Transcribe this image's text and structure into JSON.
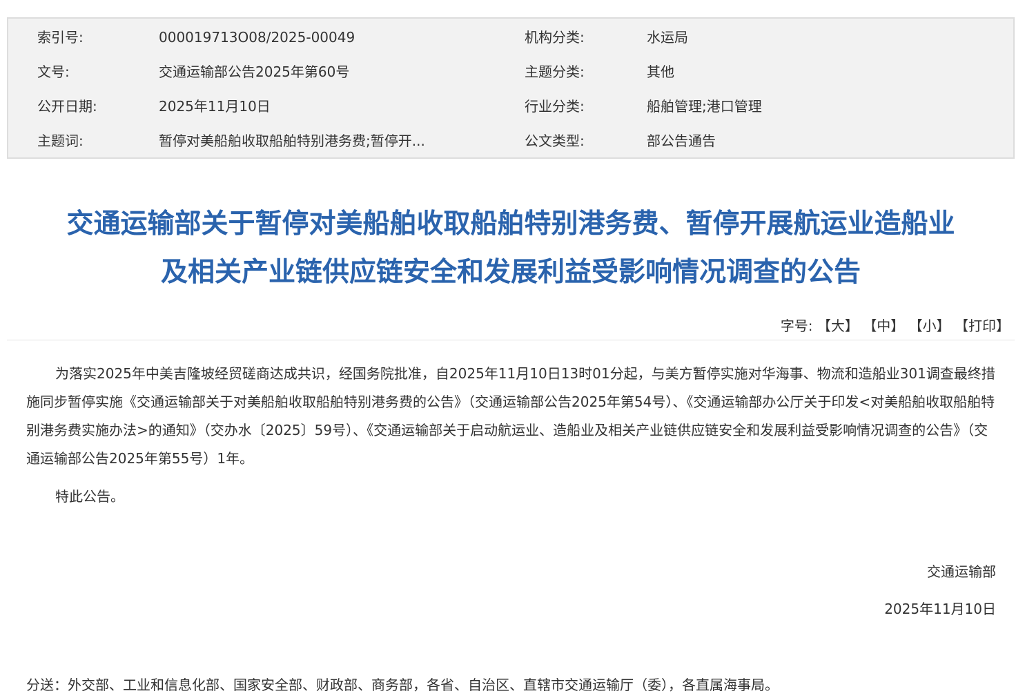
{
  "meta": {
    "index_label": "索引号:",
    "index_value": "000019713O08/2025-00049",
    "org_label": "机构分类:",
    "org_value": "水运局",
    "docno_label": "文号:",
    "docno_value": "交通运输部公告2025年第60号",
    "topic_label": "主题分类:",
    "topic_value": "其他",
    "date_label": "公开日期:",
    "date_value": "2025年11月10日",
    "industry_label": "行业分类:",
    "industry_value": "船舶管理;港口管理",
    "keywords_label": "主题词:",
    "keywords_value": "暂停对美船舶收取船舶特别港务费;暂停开...",
    "doctype_label": "公文类型:",
    "doctype_value": "部公告通告"
  },
  "title": {
    "line1": "交通运输部关于暂停对美船舶收取船舶特别港务费、暂停开展航运业造船业",
    "line2": "及相关产业链供应链安全和发展利益受影响情况调查的公告"
  },
  "font_controls": {
    "label": "字号:",
    "large": "【大】",
    "medium": "【中】",
    "small": "【小】",
    "print": "【打印】"
  },
  "body": {
    "paragraph1": "为落实2025年中美吉隆坡经贸磋商达成共识，经国务院批准，自2025年11月10日13时01分起，与美方暂停实施对华海事、物流和造船业301调查最终措施同步暂停实施《交通运输部关于对美船舶收取船舶特别港务费的公告》（交通运输部公告2025年第54号）、《交通运输部办公厅关于印发<对美船舶收取船舶特别港务费实施办法>的通知》（交办水〔2025〕59号）、《交通运输部关于启动航运业、造船业及相关产业链供应链安全和发展利益受影响情况调查的公告》（交通运输部公告2025年第55号）1年。",
    "paragraph2": "特此公告。"
  },
  "signature": {
    "org": "交通运输部",
    "date": "2025年11月10日"
  },
  "cc": "分送：外交部、工业和信息化部、国家安全部、财政部、商务部，各省、自治区、直辖市交通运输厅（委），各直属海事局。"
}
